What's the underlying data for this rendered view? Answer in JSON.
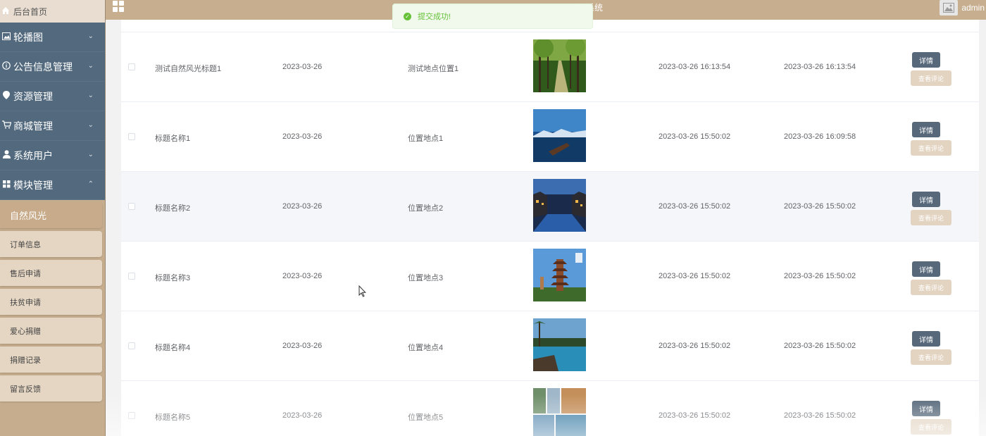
{
  "sidebar": {
    "home_label": "后台首页",
    "menus": [
      {
        "label": "轮播图",
        "icon": "image-icon"
      },
      {
        "label": "公告信息管理",
        "icon": "info-icon"
      },
      {
        "label": "资源管理",
        "icon": "location-icon"
      },
      {
        "label": "商城管理",
        "icon": "cart-icon"
      },
      {
        "label": "系统用户",
        "icon": "user-icon"
      },
      {
        "label": "模块管理",
        "icon": "grid-icon"
      }
    ],
    "sub_items": [
      "自然风光",
      "订单信息",
      "售后申请",
      "扶贫申请",
      "爱心捐赠",
      "捐赠记录",
      "留言反馈"
    ],
    "active_sub": "自然风光"
  },
  "topbar": {
    "title_visible": "作系统",
    "user": "admin"
  },
  "toast": {
    "message": "提交成功!",
    "color": "#67c23a"
  },
  "table": {
    "rows": [
      {
        "title": "测试自然风光标题1",
        "date": "2023-03-26",
        "location": "测试地点位置1",
        "image": "forest-path",
        "created": "2023-03-26 16:13:54",
        "updated": "2023-03-26 16:13:54"
      },
      {
        "title": "标题名称1",
        "date": "2023-03-26",
        "location": "位置地点1",
        "image": "lake-boat",
        "created": "2023-03-26 15:50:02",
        "updated": "2023-03-26 16:09:58"
      },
      {
        "title": "标题名称2",
        "date": "2023-03-26",
        "location": "位置地点2",
        "image": "water-town",
        "created": "2023-03-26 15:50:02",
        "updated": "2023-03-26 15:50:02"
      },
      {
        "title": "标题名称3",
        "date": "2023-03-26",
        "location": "位置地点3",
        "image": "pagoda",
        "created": "2023-03-26 15:50:02",
        "updated": "2023-03-26 15:50:02"
      },
      {
        "title": "标题名称4",
        "date": "2023-03-26",
        "location": "位置地点4",
        "image": "resort-pool",
        "created": "2023-03-26 15:50:02",
        "updated": "2023-03-26 15:50:02"
      },
      {
        "title": "标题名称5",
        "date": "2023-03-26",
        "location": "位置地点5",
        "image": "collage",
        "created": "2023-03-26 15:50:02",
        "updated": "2023-03-26 15:50:02"
      }
    ],
    "detail_label": "详情",
    "comment_label": "查看评论"
  },
  "colors": {
    "sidebar_menu": "#536a7e",
    "accent": "#c7ae8f",
    "detail_button": "#56687a"
  }
}
